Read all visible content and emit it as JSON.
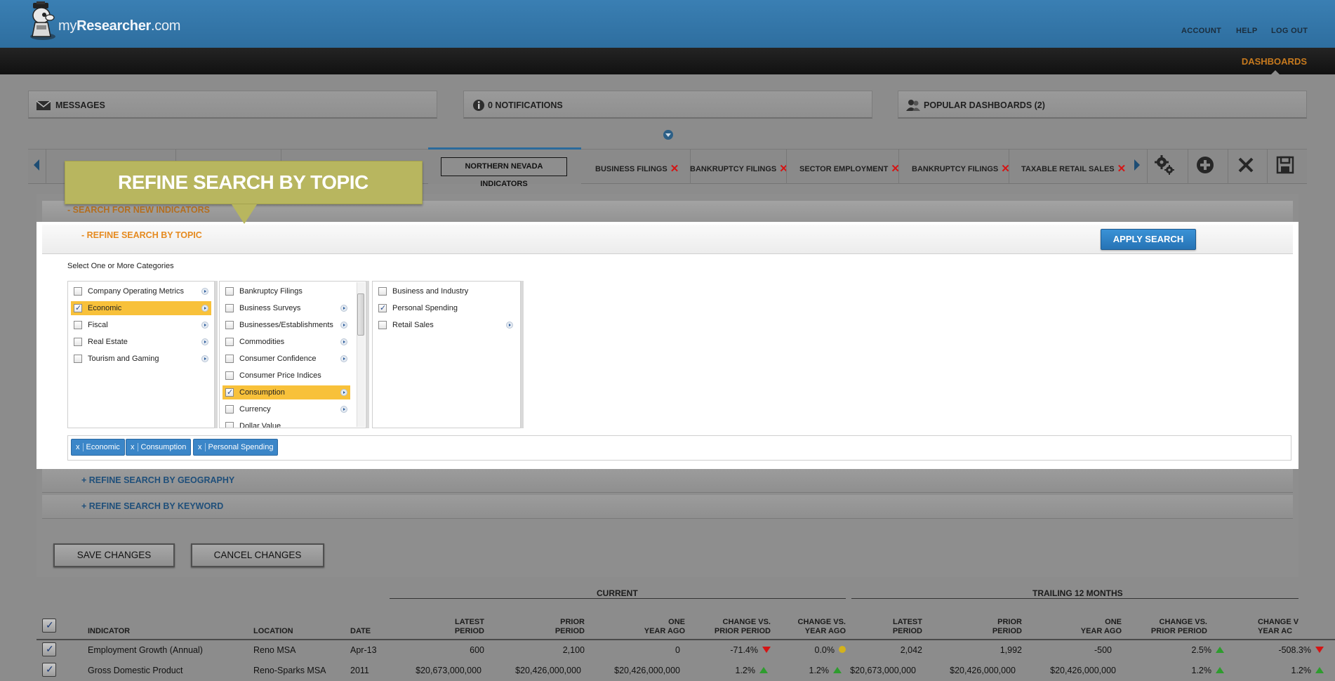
{
  "header": {
    "logo_text_plain": "my",
    "logo_text_bold": "Researcher",
    "logo_text_suffix": ".com",
    "links": {
      "account": "ACCOUNT",
      "help": "HELP",
      "logout": "LOG OUT"
    },
    "nav_active": "DASHBOARDS"
  },
  "messages": {
    "messages_label": "MESSAGES",
    "notifications_label": "0 NOTIFICATIONS",
    "popular_label": "POPULAR DASHBOARDS (2)"
  },
  "tabs": {
    "active": "NORTHERN NEVADA INDICATORS",
    "items": [
      {
        "label": "BUSINESS FILINGS"
      },
      {
        "label": "BANKRUPTCY FILINGS"
      },
      {
        "label": "SECTOR EMPLOYMENT"
      },
      {
        "label": "BANKRUPTCY FILINGS"
      },
      {
        "label": "TAXABLE RETAIL SALES"
      }
    ],
    "close_glyph": "✕"
  },
  "callout": {
    "text": "REFINE SEARCH BY TOPIC"
  },
  "search": {
    "new_indicators": "- SEARCH FOR NEW INDICATORS",
    "refine_topic": "- REFINE SEARCH BY TOPIC",
    "apply_label": "APPLY SEARCH",
    "instructions": "Select One or More Categories",
    "refine_geography": "+ REFINE SEARCH BY GEOGRAPHY",
    "refine_keyword": "+ REFINE SEARCH BY KEYWORD"
  },
  "categories": {
    "col1": [
      {
        "label": "Company Operating Metrics",
        "checked": false,
        "selected": false,
        "arrow": true
      },
      {
        "label": "Economic",
        "checked": true,
        "selected": true,
        "arrow": true
      },
      {
        "label": "Fiscal",
        "checked": false,
        "selected": false,
        "arrow": true
      },
      {
        "label": "Real Estate",
        "checked": false,
        "selected": false,
        "arrow": true
      },
      {
        "label": "Tourism and Gaming",
        "checked": false,
        "selected": false,
        "arrow": true
      }
    ],
    "col2": [
      {
        "label": "Bankruptcy Filings",
        "checked": false,
        "selected": false,
        "arrow": false
      },
      {
        "label": "Business Surveys",
        "checked": false,
        "selected": false,
        "arrow": true
      },
      {
        "label": "Businesses/Establishments",
        "checked": false,
        "selected": false,
        "arrow": true
      },
      {
        "label": "Commodities",
        "checked": false,
        "selected": false,
        "arrow": true
      },
      {
        "label": "Consumer Confidence",
        "checked": false,
        "selected": false,
        "arrow": true
      },
      {
        "label": "Consumer Price Indices",
        "checked": false,
        "selected": false,
        "arrow": false
      },
      {
        "label": "Consumption",
        "checked": true,
        "selected": true,
        "arrow": true
      },
      {
        "label": "Currency",
        "checked": false,
        "selected": false,
        "arrow": true
      },
      {
        "label": "Dollar Value",
        "checked": false,
        "selected": false,
        "arrow": false
      }
    ],
    "col3": [
      {
        "label": "Business and Industry",
        "checked": false,
        "selected": false,
        "arrow": false
      },
      {
        "label": "Personal Spending",
        "checked": true,
        "selected": false,
        "arrow": false
      },
      {
        "label": "Retail Sales",
        "checked": false,
        "selected": false,
        "arrow": true
      }
    ]
  },
  "chips": [
    {
      "x": "x",
      "label": "Economic"
    },
    {
      "x": "x",
      "label": "Consumption"
    },
    {
      "x": "x",
      "label": "Personal Spending"
    }
  ],
  "buttons": {
    "save": "SAVE CHANGES",
    "cancel": "CANCEL CHANGES"
  },
  "table": {
    "group_current": "CURRENT",
    "group_trailing": "TRAILING 12 MONTHS",
    "headers": {
      "indicator": "INDICATOR",
      "location": "LOCATION",
      "date": "DATE",
      "latest_1": "LATEST",
      "latest_2": "PERIOD",
      "prior_1": "PRIOR",
      "prior_2": "PERIOD",
      "oneyear_1": "ONE",
      "oneyear_2": "YEAR AGO",
      "chgprior_1": "CHANGE VS.",
      "chgprior_2": "PRIOR PERIOD",
      "chgyear_1": "CHANGE VS.",
      "chgyear_2": "YEAR AGO",
      "t_latest_1": "LATEST",
      "t_latest_2": "PERIOD",
      "t_prior_1": "PRIOR",
      "t_prior_2": "PERIOD",
      "t_oneyear_1": "ONE",
      "t_oneyear_2": "YEAR AGO",
      "t_chgprior_1": "CHANGE VS.",
      "t_chgprior_2": "PRIOR PERIOD",
      "t_chgyear_1": "CHANGE V",
      "t_chgyear_2": "YEAR AC"
    },
    "rows": [
      {
        "indicator": "Employment Growth (Annual)",
        "location": "Reno MSA",
        "date": "Apr-13",
        "latest": "600",
        "prior": "2,100",
        "oneyear": "0",
        "chgprior": "-71.4%",
        "chgprior_dir": "down",
        "chgyear": "0.0%",
        "chgyear_dir": "flat",
        "t_latest": "2,042",
        "t_prior": "1,992",
        "t_oneyear": "-500",
        "t_chgprior": "2.5%",
        "t_chgprior_dir": "up",
        "t_chgyear": "-508.3%",
        "t_chgyear_dir": "down"
      },
      {
        "indicator": "Gross Domestic Product",
        "location": "Reno-Sparks MSA",
        "date": "2011",
        "latest": "$20,673,000,000",
        "prior": "$20,426,000,000",
        "oneyear": "$20,426,000,000",
        "chgprior": "1.2%",
        "chgprior_dir": "up",
        "chgyear": "1.2%",
        "chgyear_dir": "up",
        "t_latest": "$20,673,000,000",
        "t_prior": "$20,426,000,000",
        "t_oneyear": "$20,426,000,000",
        "t_chgprior": "1.2%",
        "t_chgprior_dir": "up",
        "t_chgyear": "1.2%",
        "t_chgyear_dir": "up"
      }
    ]
  },
  "colors": {
    "header_blue": "#3a7fb3",
    "accent_orange": "#e58a1f",
    "selected_row": "#f8c13a",
    "chip_blue": "#3b86c8",
    "callout_olive": "#b8b65f",
    "close_red": "#d51414",
    "up_green": "#2e9c2e"
  }
}
